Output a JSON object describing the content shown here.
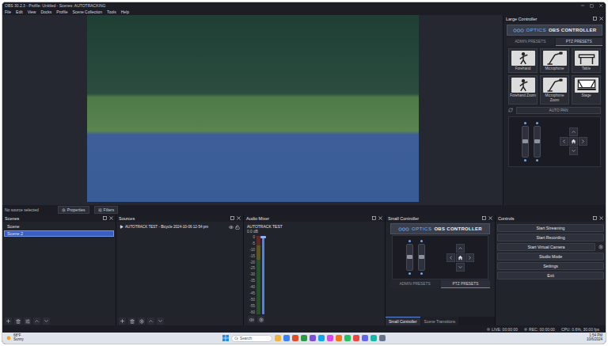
{
  "window": {
    "title": "OBS 30.2.3 - Profile: Untitled - Scenes: AUTOTRACKING"
  },
  "menu": [
    "File",
    "Edit",
    "View",
    "Docks",
    "Profile",
    "Scene Collection",
    "Tools",
    "Help"
  ],
  "large_controller": {
    "title": "Large Controller",
    "logo_brand": "OPTICS",
    "logo_product": "OBS CONTROLLER",
    "tabs": [
      {
        "label": "ADMIN PRESETS",
        "selected": false
      },
      {
        "label": "PTZ PRESETS",
        "selected": true
      }
    ],
    "presets": [
      {
        "label": "Forehand",
        "kind": "person"
      },
      {
        "label": "Microphone",
        "kind": "microphone"
      },
      {
        "label": "Table",
        "kind": "table"
      },
      {
        "label": "Forehand Zoom",
        "kind": "person"
      },
      {
        "label": "Microphone Zoom",
        "kind": "microphone"
      },
      {
        "label": "Stage",
        "kind": "stage"
      }
    ],
    "auto_pan": "AUTO PAN",
    "zoom_level": 0.5,
    "focus_level": 0.5
  },
  "preview_toolbar": {
    "status": "No source selected",
    "buttons": [
      "Properties",
      "Filters"
    ]
  },
  "scenes": {
    "title": "Scenes",
    "items": [
      {
        "name": "Scene",
        "selected": false
      },
      {
        "name": "Scene 2",
        "selected": true
      }
    ]
  },
  "sources": {
    "title": "Sources",
    "items": [
      {
        "name": "AUTOTRACK TEST - Bicycle 2024-10-06 12-54 pm",
        "visible": true,
        "locked": false
      }
    ]
  },
  "audio_mixer": {
    "title": "Audio Mixer",
    "channels": [
      {
        "name": "AUTOTRACK TEST",
        "reading": "0.0 dB",
        "level": 0,
        "volume": 1,
        "muted": false
      }
    ],
    "ticks": [
      "0",
      "-5",
      "-10",
      "-15",
      "-20",
      "-25",
      "-30",
      "-35",
      "-40",
      "-45",
      "-50",
      "-55",
      "-60"
    ]
  },
  "small_controller": {
    "title": "Small Controller",
    "logo_brand": "OPTICS",
    "logo_product": "OBS CONTROLLER",
    "tabs": [
      {
        "label": "ADMIN PRESETS",
        "selected": false
      },
      {
        "label": "PTZ PRESETS",
        "selected": true
      }
    ],
    "zoom_level": 0.5,
    "focus_level": 0.5,
    "dock_tabs": [
      {
        "label": "Small Controller",
        "selected": true
      },
      {
        "label": "Scene Transitions",
        "selected": false
      }
    ]
  },
  "controls": {
    "title": "Controls",
    "buttons": [
      {
        "label": "Start Streaming",
        "has_settings": false
      },
      {
        "label": "Start Recording",
        "has_settings": false
      },
      {
        "label": "Start Virtual Camera",
        "has_settings": true
      },
      {
        "label": "Studio Mode",
        "has_settings": false
      },
      {
        "label": "Settings",
        "has_settings": false
      },
      {
        "label": "Exit",
        "has_settings": false
      }
    ]
  },
  "status_bar": {
    "live": "LIVE: 00:00:00",
    "rec": "REC: 00:00:00",
    "cpu": "CPU: 0.6%, 30.00 fps"
  },
  "taskbar": {
    "temperature": "68°F",
    "weather": "Sunny",
    "search": "Search",
    "time": "1:54 PM",
    "date": "10/6/2024"
  }
}
